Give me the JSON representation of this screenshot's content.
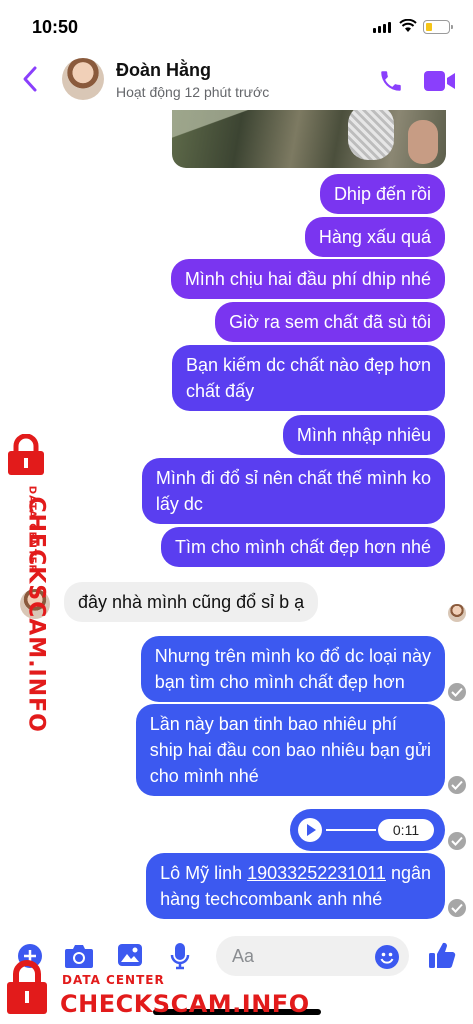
{
  "status_bar": {
    "time": "10:50"
  },
  "header": {
    "contact_name": "Đoàn Hằng",
    "activity": "Hoạt động 12 phút trước"
  },
  "messages": [
    {
      "text": "Dhip đến rồi"
    },
    {
      "text": "Hàng xấu quá"
    },
    {
      "text": "Mình chịu hai đầu phí dhip nhé"
    },
    {
      "text": "Giờ ra sem chất đã sù tôi"
    },
    {
      "line1": "Bạn kiếm dc chất nào đẹp hơn",
      "line2": "chất đấy"
    },
    {
      "text": "Mình nhập nhiêu"
    },
    {
      "line1": "Mình đi đổ sỉ nên chất thế mình ko",
      "line2": "lấy dc"
    },
    {
      "text": "Tìm cho mình chất đẹp hơn nhé"
    },
    {
      "text": "đây nhà mình cũng đổ sỉ b ạ"
    },
    {
      "line1": "Nhưng trên mình ko đổ dc loại này",
      "line2": "bạn tìm cho mình chất đẹp hơn"
    },
    {
      "line1": "Lần này ban tinh bao nhiêu phí",
      "line2": "ship hai đầu con bao nhiêu bạn gửi",
      "line3": "cho mình nhé"
    },
    {
      "line1_prefix": "Lô Mỹ linh ",
      "account_number": "19033252231011",
      "line1_suffix": " ngân",
      "line2": "hàng techcombank anh nhé"
    }
  ],
  "voice_message": {
    "duration": "0:11"
  },
  "composer": {
    "placeholder": "Aa"
  },
  "watermark": {
    "sub_label": "DATA CENTER",
    "brand": "CHECKSCAM.INFO"
  },
  "colors": {
    "accent": "#8a3ffc",
    "bubble_purple": "#7a35f0",
    "bubble_violet": "#5a3ef0",
    "bubble_blue": "#3c59f0",
    "watermark_red": "#e21b1b"
  }
}
